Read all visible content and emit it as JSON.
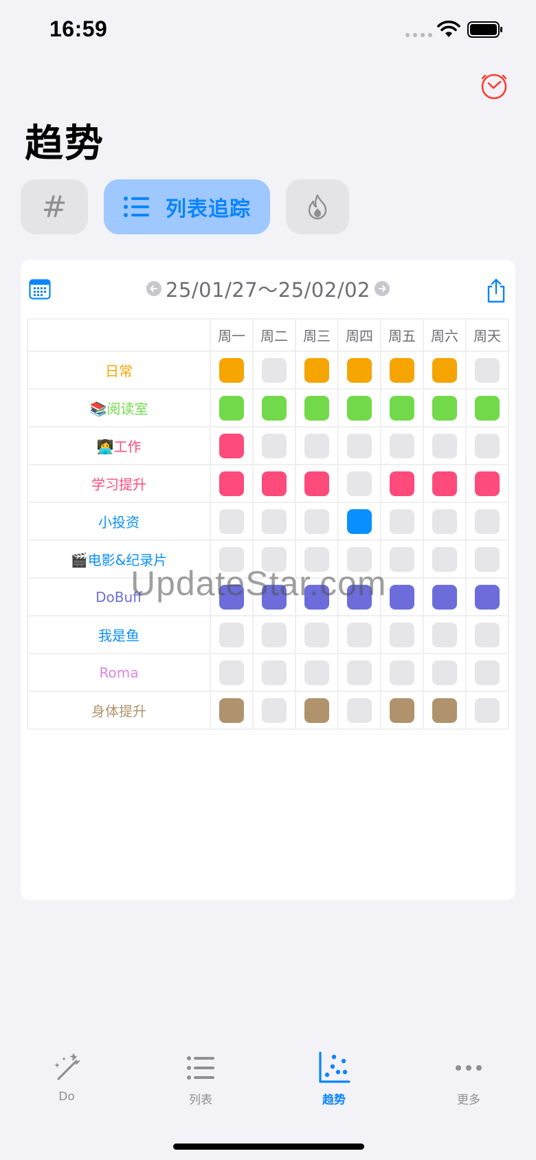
{
  "status_bar": {
    "time": "16:59"
  },
  "page": {
    "title": "趋势"
  },
  "tabs": [
    {
      "id": "hash",
      "label": "#"
    },
    {
      "id": "list",
      "label": "列表追踪",
      "selected": true
    },
    {
      "id": "fire",
      "label": ""
    }
  ],
  "card": {
    "date_range": "25/01/27～25/02/02",
    "weekdays": [
      "周一",
      "周二",
      "周三",
      "周四",
      "周五",
      "周六",
      "周天"
    ],
    "rows": [
      {
        "name": "日常",
        "color": "#f5a400",
        "done": [
          1,
          0,
          1,
          1,
          1,
          1,
          0
        ]
      },
      {
        "name": "📚阅读室",
        "color": "#72d94a",
        "done": [
          1,
          1,
          1,
          1,
          1,
          1,
          1
        ]
      },
      {
        "name": "👩‍💻工作",
        "color": "#ff4a7c",
        "done": [
          1,
          0,
          0,
          0,
          0,
          0,
          0
        ]
      },
      {
        "name": "学习提升",
        "color": "#ff4a7c",
        "done": [
          1,
          1,
          1,
          0,
          1,
          1,
          1
        ]
      },
      {
        "name": "小投资",
        "color": "#0a8fff",
        "done": [
          0,
          0,
          0,
          1,
          0,
          0,
          0
        ]
      },
      {
        "name": "🎬电影&纪录片",
        "color": "#0a8fff",
        "done": [
          0,
          0,
          0,
          0,
          0,
          0,
          0
        ]
      },
      {
        "name": "DoBuff",
        "color": "#6c6ddb",
        "done": [
          1,
          1,
          1,
          1,
          1,
          1,
          1
        ]
      },
      {
        "name": "我是鱼",
        "color": "#0a8fff",
        "done": [
          0,
          0,
          0,
          0,
          0,
          0,
          0
        ]
      },
      {
        "name": "Roma",
        "color": "#da86e2",
        "done": [
          0,
          0,
          0,
          0,
          0,
          0,
          0
        ]
      },
      {
        "name": "身体提升",
        "color": "#b0936c",
        "done": [
          1,
          0,
          1,
          0,
          1,
          1,
          0
        ]
      }
    ],
    "empty_color": "#e6e6e9"
  },
  "watermark": "UpdateStar.com",
  "tab_bar": [
    {
      "label": "Do",
      "icon": "magic-wand-icon"
    },
    {
      "label": "列表",
      "icon": "list-icon"
    },
    {
      "label": "趋势",
      "icon": "scatter-chart-icon",
      "active": true
    },
    {
      "label": "更多",
      "icon": "more-icon"
    }
  ],
  "colors": {
    "accent": "#0a84ff",
    "alert": "#ff3b30"
  }
}
